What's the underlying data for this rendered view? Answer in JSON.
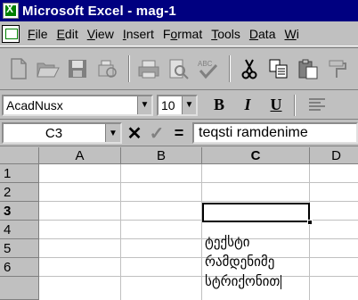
{
  "window": {
    "title": "Microsoft Excel - mag-1"
  },
  "menu": {
    "items": [
      {
        "key": "F",
        "rest": "ile"
      },
      {
        "key": "E",
        "rest": "dit"
      },
      {
        "key": "V",
        "rest": "iew"
      },
      {
        "key": "I",
        "rest": "nsert"
      },
      {
        "pre": "F",
        "key": "o",
        "rest": "rmat"
      },
      {
        "key": "T",
        "rest": "ools"
      },
      {
        "key": "D",
        "rest": "ata"
      },
      {
        "key": "W",
        "rest": "i"
      }
    ]
  },
  "toolbar": {
    "icons": [
      "new-icon",
      "open-icon",
      "save-icon",
      "print-preview-icon",
      "print-icon",
      "preview-icon",
      "spelling-icon",
      "cut-icon",
      "copy-icon",
      "paste-icon",
      "format-painter-icon"
    ]
  },
  "format_bar": {
    "font_name": "AcadNusx",
    "font_size": "10",
    "bold": "B",
    "italic": "I",
    "underline": "U"
  },
  "formula_bar": {
    "name_box": "C3",
    "cancel": "✕",
    "enter": "✓",
    "equals": "=",
    "content": "teqsti ramdenime"
  },
  "grid": {
    "columns": [
      "A",
      "B",
      "C",
      "D"
    ],
    "rows": [
      "1",
      "2",
      "3",
      "4",
      "5",
      "6"
    ],
    "active_column": "C",
    "active_row": "3",
    "cells": {
      "C4": "ტექსტი",
      "C5": "რამდენიმე",
      "C6": "სტრიქონით"
    }
  },
  "colors": {
    "title_bar": "#000080",
    "chrome": "#c0c0c0",
    "grid_lines": "#c0c0c0"
  }
}
